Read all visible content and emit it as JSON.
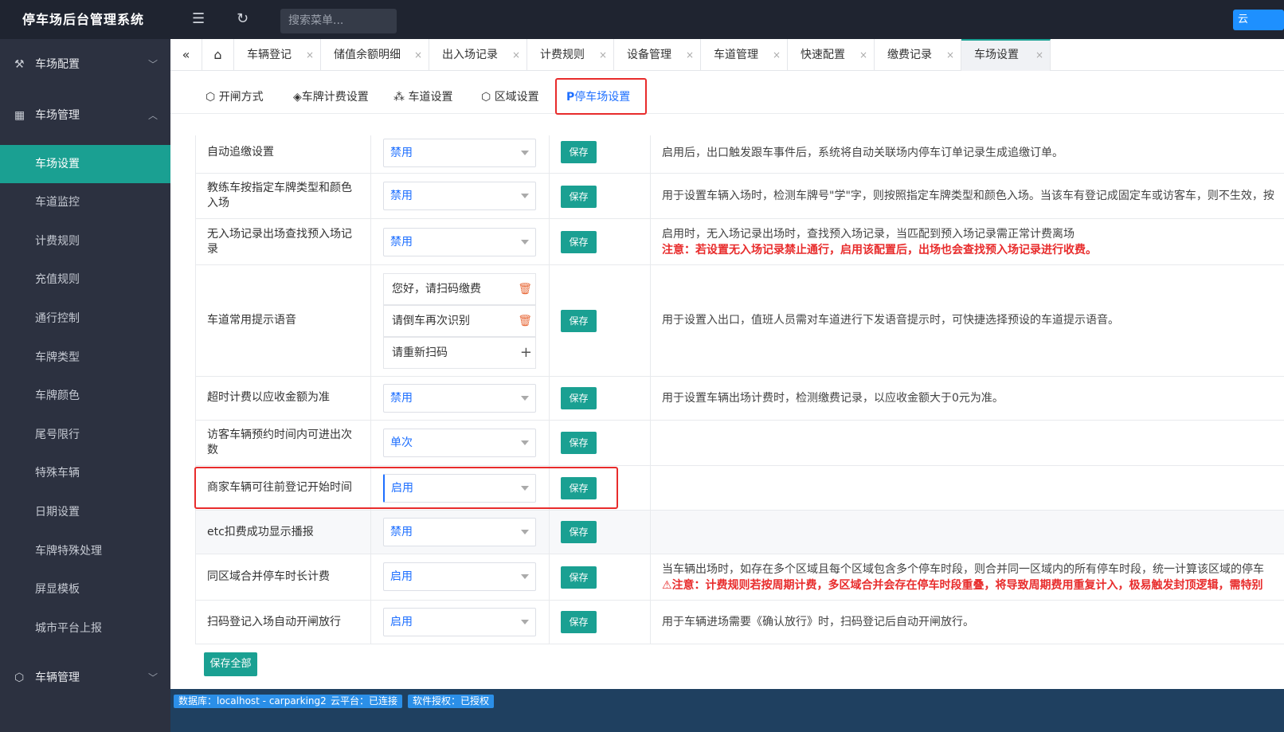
{
  "app": {
    "title": "停车场后台管理系统"
  },
  "header": {
    "search_placeholder": "搜索菜单...",
    "cloud_button": "云"
  },
  "sidebar": {
    "groups": [
      {
        "label": "车场配置",
        "expanded": false
      },
      {
        "label": "车场管理",
        "expanded": true
      },
      {
        "label": "车辆管理",
        "expanded": false
      }
    ],
    "items": [
      "车场设置",
      "车道监控",
      "计费规则",
      "充值规则",
      "通行控制",
      "车牌类型",
      "车牌颜色",
      "尾号限行",
      "特殊车辆",
      "日期设置",
      "车牌特殊处理",
      "屏显模板",
      "城市平台上报"
    ],
    "active_item": "车场设置"
  },
  "tabs": [
    "车辆登记",
    "储值余额明细",
    "出入场记录",
    "计费规则",
    "设备管理",
    "车道管理",
    "快速配置",
    "缴费记录",
    "车场设置"
  ],
  "active_tab": "车场设置",
  "subtabs": [
    "开闸方式",
    "车牌计费设置",
    "车道设置",
    "区域设置",
    "停车场设置"
  ],
  "active_subtab": "停车场设置",
  "settings": [
    {
      "label": "自动追缴设置",
      "value": "禁用",
      "save": "保存",
      "desc": "启用后，出口触发跟车事件后，系统将自动关联场内停车订单记录生成追缴订单。"
    },
    {
      "label": "教练车按指定车牌类型和颜色入场",
      "value": "禁用",
      "save": "保存",
      "desc": "用于设置车辆入场时，检测车牌号\"学\"字，则按照指定车牌类型和颜色入场。当该车有登记成固定车或访客车，则不生效，按"
    },
    {
      "label": "无入场记录出场查找预入场记录",
      "value": "禁用",
      "save": "保存",
      "desc": "启用时，无入场记录出场时，查找预入场记录，当匹配到预入场记录需正常计费离场",
      "warn": "注意：若设置无入场记录禁止通行，启用该配置后，出场也会查找预入场记录进行收费。"
    },
    {
      "label": "车道常用提示语音",
      "voices": [
        "您好，请扫码缴费",
        "请倒车再次识别",
        "请重新扫码"
      ],
      "save": "保存",
      "desc": "用于设置入出口，值班人员需对车道进行下发语音提示时，可快捷选择预设的车道提示语音。"
    },
    {
      "label": "超时计费以应收金额为准",
      "value": "禁用",
      "save": "保存",
      "desc": "用于设置车辆出场计费时，检测缴费记录，以应收金额大于0元为准。"
    },
    {
      "label": "访客车辆预约时间内可进出次数",
      "value": "单次",
      "save": "保存",
      "desc": ""
    },
    {
      "label": "商家车辆可往前登记开始时间",
      "value": "启用",
      "save": "保存",
      "desc": ""
    },
    {
      "label": "etc扣费成功显示播报",
      "value": "禁用",
      "save": "保存",
      "desc": ""
    },
    {
      "label": "同区域合并停车时长计费",
      "value": "启用",
      "save": "保存",
      "desc": "当车辆出场时，如存在多个区域且每个区域包含多个停车时段，则合并同一区域内的所有停车时段，统一计算该区域的停车",
      "warn": "注意：计费规则若按周期计费，多区域合并会存在停车时段重叠，将导致周期费用重复计入，极易触发封顶逻辑，需特别"
    },
    {
      "label": "扫码登记入场自动开闸放行",
      "value": "启用",
      "save": "保存",
      "desc": "用于车辆进场需要《确认放行》时，扫码登记后自动开闸放行。"
    }
  ],
  "save_all": "保存全部",
  "status": [
    "数据库：localhost - carparking2",
    "云平台：已连接",
    "软件授权：已授权"
  ]
}
